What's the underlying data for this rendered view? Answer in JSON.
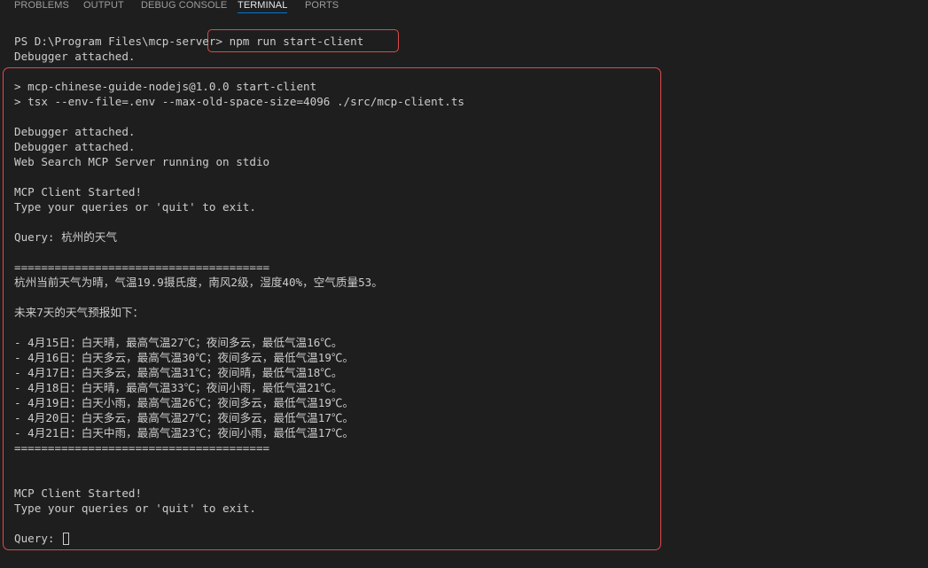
{
  "tabs": [
    {
      "label": "PROBLEMS"
    },
    {
      "label": "OUTPUT"
    },
    {
      "label": "DEBUG CONSOLE"
    },
    {
      "label": "TERMINAL"
    },
    {
      "label": "PORTS"
    }
  ],
  "terminal": {
    "prompt": "PS D:\\Program Files\\mcp-server>",
    "command": " npm run start-client",
    "lines": [
      "Debugger attached.",
      "",
      "> mcp-chinese-guide-nodejs@1.0.0 start-client",
      "> tsx --env-file=.env --max-old-space-size=4096 ./src/mcp-client.ts",
      "",
      "Debugger attached.",
      "Debugger attached.",
      "Web Search MCP Server running on stdio",
      "",
      "MCP Client Started!",
      "Type your queries or 'quit' to exit.",
      "",
      "Query: 杭州的天气",
      "",
      "======================================",
      "杭州当前天气为晴，气温19.9摄氏度，南风2级，湿度40%，空气质量53。",
      "",
      "未来7天的天气预报如下：",
      "",
      "- 4月15日：白天晴，最高气温27℃；夜间多云，最低气温16℃。",
      "- 4月16日：白天多云，最高气温30℃；夜间多云，最低气温19℃。",
      "- 4月17日：白天多云，最高气温31℃；夜间晴，最低气温18℃。",
      "- 4月18日：白天晴，最高气温33℃；夜间小雨，最低气温21℃。",
      "- 4月19日：白天小雨，最高气温26℃；夜间多云，最低气温19℃。",
      "- 4月20日：白天多云，最高气温27℃；夜间多云，最低气温17℃。",
      "- 4月21日：白天中雨，最高气温23℃；夜间小雨，最低气温17℃。",
      "======================================",
      "",
      "",
      "MCP Client Started!",
      "Type your queries or 'quit' to exit.",
      ""
    ],
    "input_prompt": "Query: "
  }
}
